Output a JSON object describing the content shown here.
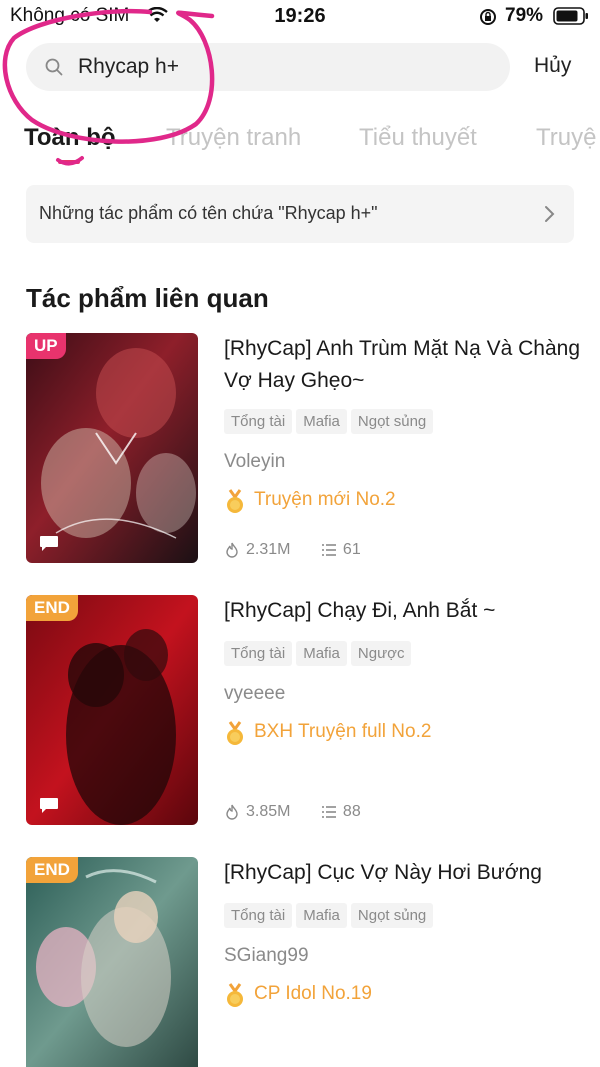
{
  "status_bar": {
    "carrier": "Không có SIM",
    "time": "19:26",
    "battery_percent": "79%"
  },
  "search": {
    "query": "Rhycap h+",
    "cancel_label": "Hủy"
  },
  "tabs": [
    {
      "label": "Toàn bộ",
      "active": true
    },
    {
      "label": "Truyện tranh",
      "active": false
    },
    {
      "label": "Tiểu thuyết",
      "active": false
    },
    {
      "label": "Truyệ",
      "active": false
    }
  ],
  "exact_match": {
    "label": "Những tác phẩm có tên chứa \"Rhycap h+\""
  },
  "related": {
    "title": "Tác phẩm liên quan",
    "items": [
      {
        "badge": "UP",
        "title": "[RhyCap] Anh Trùm Mặt Nạ Và Chàng Vợ Hay Ghẹo~",
        "tags": [
          "Tổng tài",
          "Mafia",
          "Ngọt sủng"
        ],
        "author": "Voleyin",
        "rank": "Truyện mới No.2",
        "views": "2.31M",
        "chapters": "61"
      },
      {
        "badge": "END",
        "title": "[RhyCap] Chạy Đi, Anh Bắt ~",
        "tags": [
          "Tổng tài",
          "Mafia",
          "Ngược"
        ],
        "author": "vyeeee",
        "rank": "BXH Truyện full No.2",
        "views": "3.85M",
        "chapters": "88"
      },
      {
        "badge": "END",
        "title": "[RhyCap] Cục Vợ Này Hơi Bướng",
        "tags": [
          "Tổng tài",
          "Mafia",
          "Ngọt sủng"
        ],
        "author": "SGiang99",
        "rank": "CP Idol No.19"
      }
    ]
  },
  "colors": {
    "accent": "#e8336d",
    "rank": "#f2a33a",
    "muted": "#8a8a8a",
    "annotation": "#e0288a"
  }
}
